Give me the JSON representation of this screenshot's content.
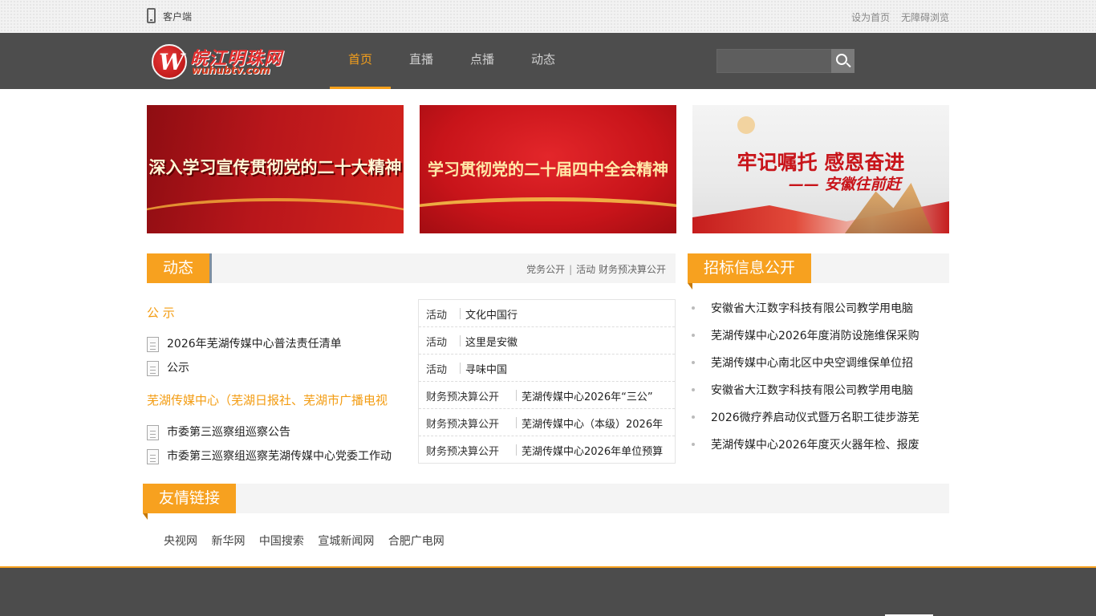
{
  "topbar": {
    "client_label": "客户端",
    "set_home": "设为首页",
    "accessible": "无障碍浏览"
  },
  "logo": {
    "cn": "皖江明珠网",
    "en": "wuhubtv.com",
    "badge": "W"
  },
  "nav": {
    "items": [
      "首页",
      "直播",
      "点播",
      "动态"
    ],
    "active_index": 0
  },
  "search": {
    "placeholder": "",
    "value": ""
  },
  "banners": [
    {
      "text": "深入学习宣传贯彻党的二十大精神"
    },
    {
      "text": "学习贯彻党的二十届四中全会精神"
    },
    {
      "text": "牢记嘱托 感恩奋进",
      "subtext": "—— 安徽往前赶"
    }
  ],
  "dongtai": {
    "title": "动态",
    "links": [
      "党务公开",
      "活动",
      "财务预决算公开"
    ],
    "subsections": [
      {
        "title": "公 示",
        "items": [
          "2026年芜湖传媒中心普法责任清单",
          "公示"
        ]
      },
      {
        "title": "芜湖传媒中心（芜湖日报社、芜湖市广播电视",
        "items": [
          "市委第三巡察组巡察公告",
          "市委第三巡察组巡察芜湖传媒中心党委工作动"
        ]
      }
    ],
    "activities": [
      {
        "category": "活动",
        "title": "文化中国行"
      },
      {
        "category": "活动",
        "title": "这里是安徽"
      },
      {
        "category": "活动",
        "title": "寻味中国"
      },
      {
        "category": "财务预决算公开",
        "title": "芜湖传媒中心2026年“三公”"
      },
      {
        "category": "财务预决算公开",
        "title": "芜湖传媒中心（本级）2026年"
      },
      {
        "category": "财务预决算公开",
        "title": "芜湖传媒中心2026年单位预算"
      }
    ]
  },
  "bidding": {
    "title": "招标信息公开",
    "items": [
      "安徽省大江数字科技有限公司教学用电脑",
      "芜湖传媒中心2026年度消防设施维保采购",
      "芜湖传媒中心南北区中央空调维保单位招",
      "安徽省大江数字科技有限公司教学用电脑",
      "2026微疗养启动仪式暨万名职工徒步游芜",
      "芜湖传媒中心2026年度灭火器年检、报废"
    ]
  },
  "friend_links": {
    "title": "友情链接",
    "items": [
      "央视网",
      "新华网",
      "中国搜索",
      "宣城新闻网",
      "合肥广电网"
    ]
  },
  "colors": {
    "accent": "#f7a11f",
    "nav_bg": "#4d4d4d",
    "brand_red": "#c8141a"
  }
}
